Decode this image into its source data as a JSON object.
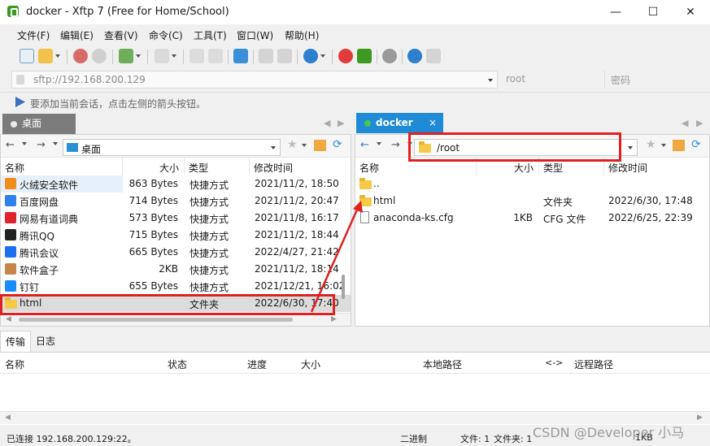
{
  "window": {
    "title": "docker - Xftp 7 (Free for Home/School)",
    "minimize": "—",
    "maximize": "☐",
    "close": "✕"
  },
  "menu": [
    "文件(F)",
    "编辑(E)",
    "查看(V)",
    "命令(C)",
    "工具(T)",
    "窗口(W)",
    "帮助(H)"
  ],
  "address": {
    "value": "sftp://192.168.200.129",
    "user": "root",
    "password_placeholder": "密码"
  },
  "hint": "要添加当前会话，点击左侧的箭头按钮。",
  "left_tab": "桌面",
  "right_tab": "docker",
  "right_tab_close": "×",
  "left_pane": {
    "path": "桌面",
    "columns": [
      "名称",
      "大小",
      "类型",
      "修改时间"
    ],
    "rows": [
      {
        "name": "火绒安全软件",
        "size": "863 Bytes",
        "type": "快捷方式",
        "modified": "2021/11/2, 18:50",
        "icon_color": "#f08c1c"
      },
      {
        "name": "百度网盘",
        "size": "714 Bytes",
        "type": "快捷方式",
        "modified": "2021/11/2, 20:47",
        "icon_color": "#2f80ed"
      },
      {
        "name": "网易有道词典",
        "size": "573 Bytes",
        "type": "快捷方式",
        "modified": "2021/11/8, 16:17",
        "icon_color": "#e0242f"
      },
      {
        "name": "腾讯QQ",
        "size": "715 Bytes",
        "type": "快捷方式",
        "modified": "2021/11/2, 18:44",
        "icon_color": "#222222"
      },
      {
        "name": "腾讯会议",
        "size": "665 Bytes",
        "type": "快捷方式",
        "modified": "2022/4/27, 21:42",
        "icon_color": "#1e6ef0"
      },
      {
        "name": "软件盒子",
        "size": "2KB",
        "type": "快捷方式",
        "modified": "2021/11/2, 18:14",
        "icon_color": "#c4864a"
      },
      {
        "name": "钉钉",
        "size": "655 Bytes",
        "type": "快捷方式",
        "modified": "2021/12/21, 16:02",
        "icon_color": "#1a8cff"
      },
      {
        "name": "html",
        "size": "",
        "type": "文件夹",
        "modified": "2022/6/30, 17:40",
        "icon_color": "#f7c948"
      }
    ]
  },
  "right_pane": {
    "path": "/root",
    "columns": [
      "名称",
      "大小",
      "类型",
      "修改时间"
    ],
    "rows": [
      {
        "name": "..",
        "size": "",
        "type": "",
        "modified": ""
      },
      {
        "name": "html",
        "size": "",
        "type": "文件夹",
        "modified": "2022/6/30, 17:48"
      },
      {
        "name": "anaconda-ks.cfg",
        "size": "1KB",
        "type": "CFG 文件",
        "modified": "2022/6/25, 22:39"
      }
    ]
  },
  "transfer": {
    "tabs": [
      "传输",
      "日志"
    ],
    "columns": [
      "名称",
      "状态",
      "进度",
      "大小",
      "本地路径",
      "<->",
      "远程路径"
    ]
  },
  "status": {
    "connection": "已连接 192.168.200.129:22。",
    "mode": "二进制",
    "files_left": "文件: 1",
    "files_right": "文件夹: 1",
    "size": "1KB"
  },
  "watermark": "CSDN @Developer 小马",
  "colors": {
    "tab_active": "#1f8ad6",
    "tab_inactive": "#7b7b7b",
    "highlight_box": "#e02020",
    "folder": "#f7c948"
  }
}
